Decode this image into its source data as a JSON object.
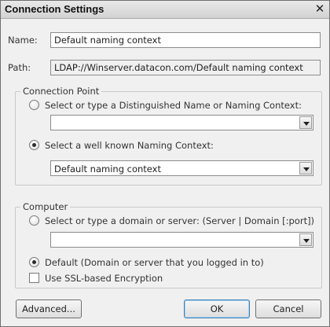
{
  "window": {
    "title": "Connection Settings",
    "close_glyph": "✕"
  },
  "name_field": {
    "label": "Name:",
    "value": "Default naming context"
  },
  "path_field": {
    "label": "Path:",
    "value": "LDAP://Winserver.datacon.com/Default naming context"
  },
  "connection_point": {
    "legend": "Connection Point",
    "option_dn_label": "Select or type a Distinguished Name or Naming Context:",
    "option_dn_selected": false,
    "dn_combo_value": "",
    "option_known_label": "Select a well known Naming Context:",
    "option_known_selected": true,
    "known_combo_value": "Default naming context"
  },
  "computer": {
    "legend": "Computer",
    "option_server_label": "Select or type a domain or server: (Server | Domain [:port])",
    "option_server_selected": false,
    "server_combo_value": "",
    "option_default_label": "Default (Domain or server that you logged in to)",
    "option_default_selected": true,
    "ssl_label": "Use SSL-based Encryption",
    "ssl_checked": false
  },
  "buttons": {
    "advanced": "Advanced...",
    "ok": "OK",
    "cancel": "Cancel"
  }
}
